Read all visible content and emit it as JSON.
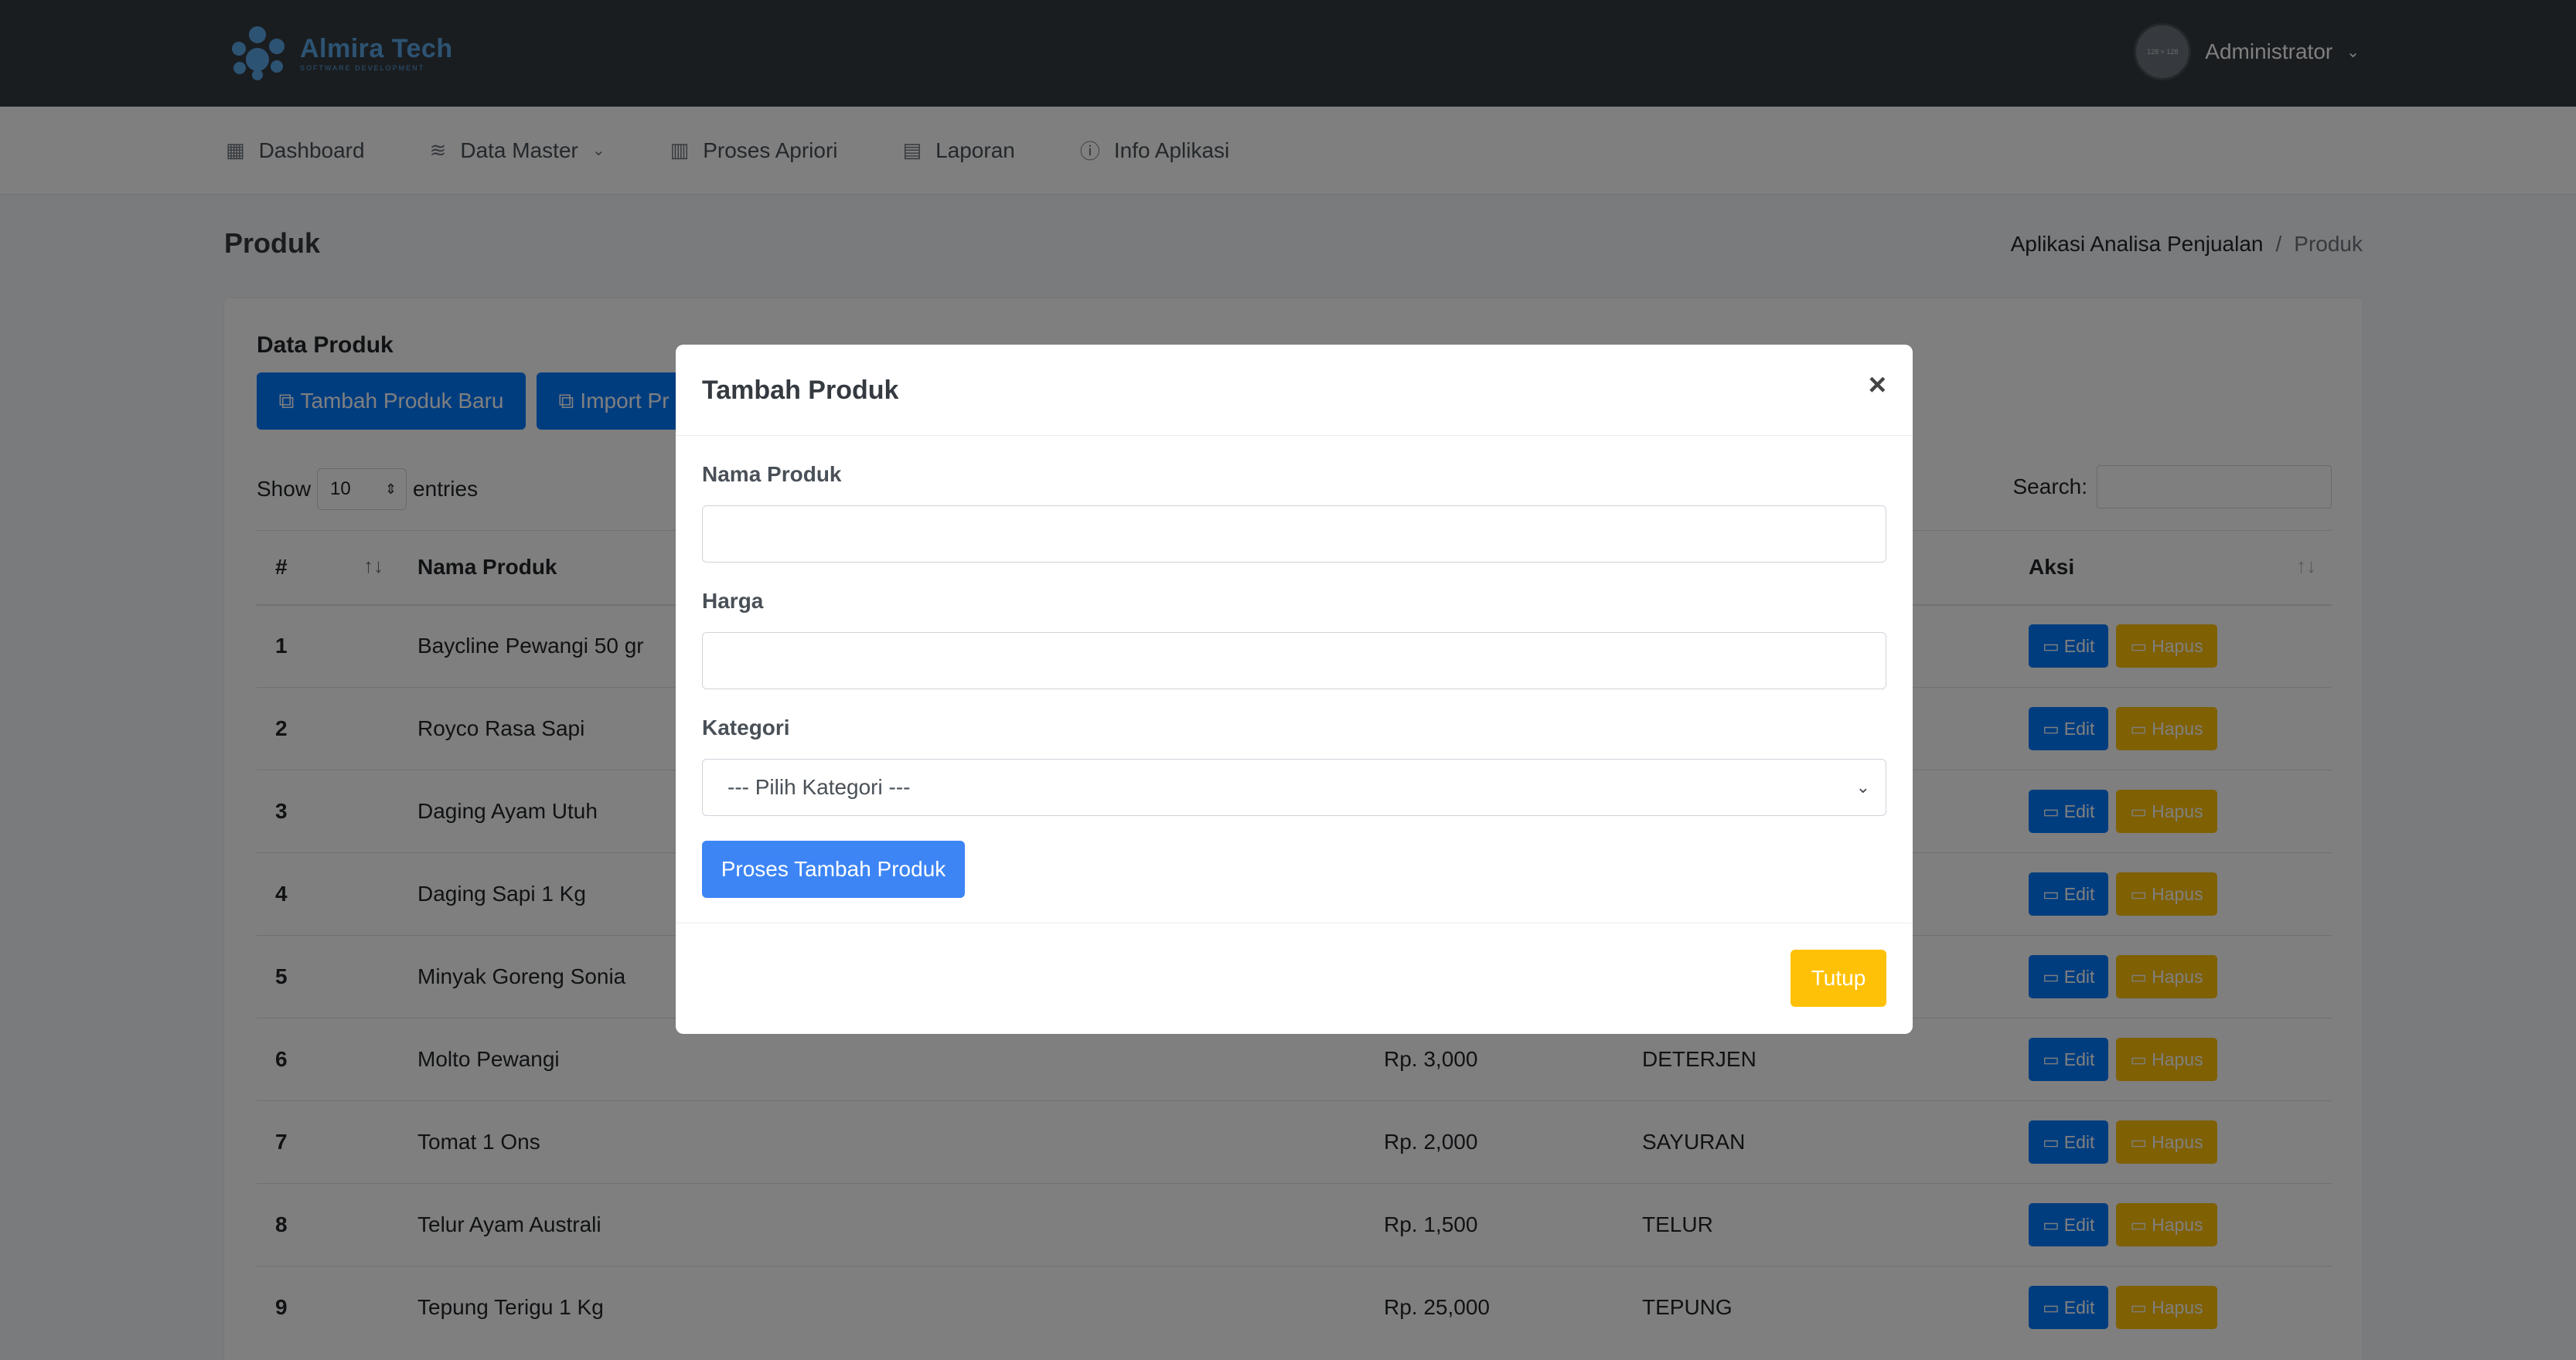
{
  "header": {
    "brand_name": "Almira Tech",
    "brand_sub": "SOFTWARE DEVELOPMENT",
    "avatar_text": "128 × 128",
    "user_name": "Administrator"
  },
  "nav": {
    "items": [
      {
        "label": "Dashboard",
        "icon": "dashboard-icon"
      },
      {
        "label": "Data Master",
        "icon": "database-icon"
      },
      {
        "label": "Proses Apriori",
        "icon": "chart-bar-icon"
      },
      {
        "label": "Laporan",
        "icon": "report-icon"
      },
      {
        "label": "Info Aplikasi",
        "icon": "info-icon"
      }
    ]
  },
  "page": {
    "title": "Produk",
    "breadcrumb": [
      "Aplikasi Analisa Penjualan",
      "/",
      "Produk"
    ]
  },
  "card": {
    "title": "Data Produk",
    "add_button": "Tambah Produk Baru",
    "import_button": "Import Pr",
    "show_label": "Show",
    "entries_value": "10",
    "entries_label": "entries",
    "search_label": "Search:"
  },
  "table": {
    "headers": [
      "#",
      "Nama Produk",
      "Aksi"
    ],
    "edit_label": "Edit",
    "delete_label": "Hapus",
    "rows": [
      {
        "no": "1",
        "name": "Baycline Pewangi 50 gr",
        "price": "",
        "category": ""
      },
      {
        "no": "2",
        "name": "Royco Rasa Sapi",
        "price": "",
        "category": ""
      },
      {
        "no": "3",
        "name": "Daging Ayam Utuh",
        "price": "",
        "category": ""
      },
      {
        "no": "4",
        "name": "Daging Sapi 1 Kg",
        "price": "",
        "category": ""
      },
      {
        "no": "5",
        "name": "Minyak Goreng Sonia",
        "price": "",
        "category": ""
      },
      {
        "no": "6",
        "name": "Molto Pewangi",
        "price": "Rp. 3,000",
        "category": "DETERJEN"
      },
      {
        "no": "7",
        "name": "Tomat 1 Ons",
        "price": "Rp. 2,000",
        "category": "SAYURAN"
      },
      {
        "no": "8",
        "name": "Telur Ayam Australi",
        "price": "Rp. 1,500",
        "category": "TELUR"
      },
      {
        "no": "9",
        "name": "Tepung Terigu 1 Kg",
        "price": "Rp. 25,000",
        "category": "TEPUNG"
      }
    ]
  },
  "modal": {
    "title": "Tambah Produk",
    "close_symbol": "×",
    "name_label": "Nama Produk",
    "name_value": "",
    "price_label": "Harga",
    "price_value": "",
    "category_label": "Kategori",
    "category_selected": "--- Pilih Kategori ---",
    "submit_label": "Proses Tambah Produk",
    "close_label": "Tutup"
  },
  "colors": {
    "header_bg": "#343a40",
    "primary": "#007bff",
    "warning": "#ffc107",
    "brand": "#5aa7e6"
  }
}
